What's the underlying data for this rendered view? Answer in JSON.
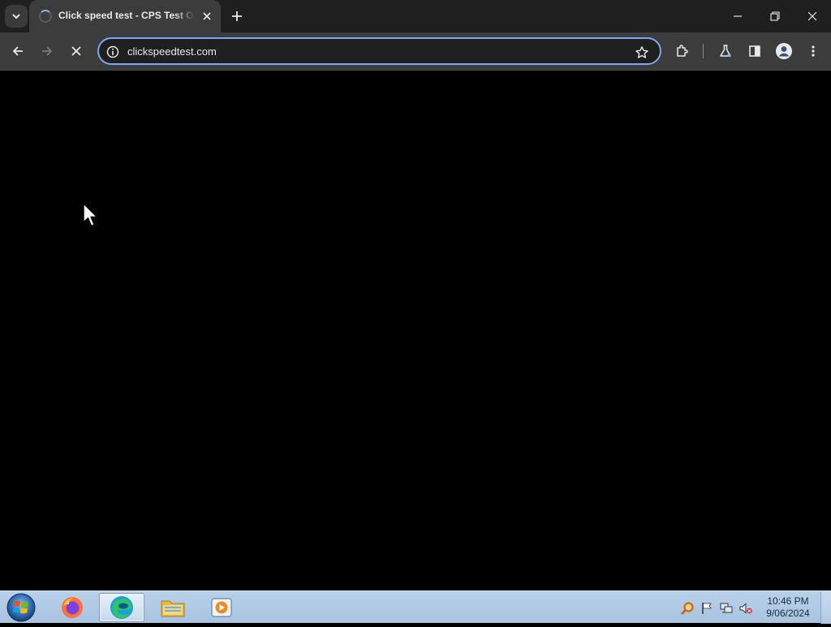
{
  "browser": {
    "tab": {
      "title": "Click speed test - CPS Test Online",
      "state": "loading"
    },
    "address_bar": {
      "url": "clickspeedtest.com"
    },
    "accent_color": "#7aa7f0",
    "icons": {
      "tab_search": "chevron-down-icon",
      "new_tab": "plus-icon",
      "back": "arrow-left-icon",
      "forward": "arrow-right-icon",
      "stop": "close-icon",
      "site_info": "info-icon",
      "bookmark": "star-icon",
      "extensions": "puzzle-icon",
      "labs": "flask-icon",
      "side_panel": "side-panel-icon",
      "profile": "profile-icon",
      "menu": "kebab-menu-icon"
    }
  },
  "taskbar": {
    "apps": [
      "firefox",
      "edge",
      "file-explorer",
      "media-player"
    ],
    "active_app": "edge",
    "clock": {
      "time": "10:46 PM",
      "date": "9/06/2024"
    }
  }
}
